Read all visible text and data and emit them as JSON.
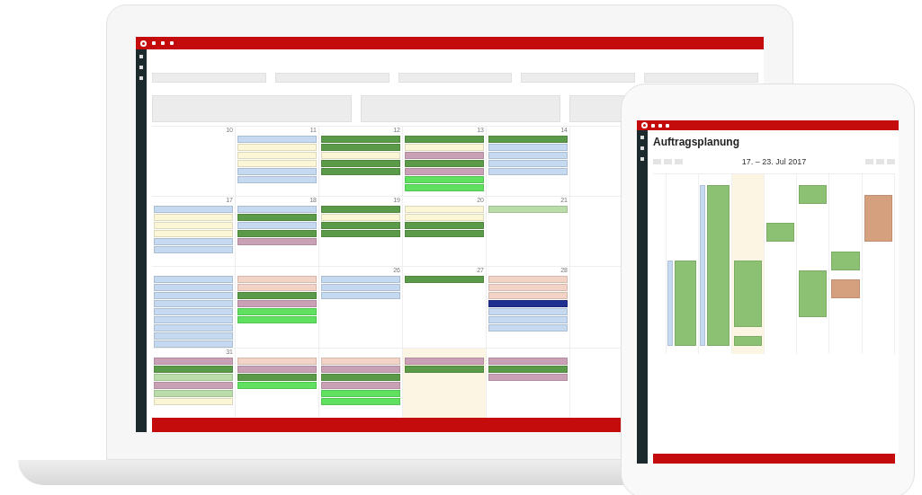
{
  "laptop": {
    "form": [
      {
        "kind": "input"
      },
      {
        "kind": "input"
      },
      {
        "kind": "input"
      },
      {
        "kind": "input"
      },
      {
        "kind": "input"
      },
      {
        "kind": "textarea"
      },
      {
        "kind": "textarea"
      },
      {
        "kind": "textarea"
      }
    ],
    "calendar": {
      "weeks": [
        {
          "days": [
            {
              "number": "10",
              "highlighted": false
            },
            {
              "number": "11",
              "highlighted": false,
              "events": [
                {
                  "color": "#c5d9f1"
                },
                {
                  "color": "#fbf6d5"
                },
                {
                  "color": "#fbf6d5"
                },
                {
                  "color": "#fbf6d5"
                },
                {
                  "color": "#c5d9f1"
                },
                {
                  "color": "#c5d9f1"
                }
              ]
            },
            {
              "number": "12",
              "highlighted": false,
              "events": [
                {
                  "color": "#5a9a48"
                },
                {
                  "color": "#5a9a48"
                },
                {
                  "color": "#fbf6d5"
                },
                {
                  "color": "#5a9a48"
                },
                {
                  "color": "#5a9a48"
                }
              ]
            },
            {
              "number": "13",
              "highlighted": false,
              "events": [
                {
                  "color": "#5a9a48"
                },
                {
                  "color": "#fbf6d5"
                },
                {
                  "color": "#c9a0b5"
                },
                {
                  "color": "#5a9a48"
                },
                {
                  "color": "#c9a0b5"
                },
                {
                  "color": "#5fe05f"
                },
                {
                  "color": "#5fe05f"
                }
              ]
            },
            {
              "number": "14",
              "highlighted": false,
              "events": [
                {
                  "color": "#5a9a48"
                },
                {
                  "color": "#c5d9f1"
                },
                {
                  "color": "#c5d9f1"
                },
                {
                  "color": "#c5d9f1"
                },
                {
                  "color": "#c5d9f1"
                }
              ]
            }
          ]
        },
        {
          "days": [
            {
              "number": "17",
              "highlighted": false,
              "events": [
                {
                  "color": "#c5d9f1"
                },
                {
                  "color": "#fbf6d5"
                },
                {
                  "color": "#fbf6d5"
                },
                {
                  "color": "#fbf6d5"
                },
                {
                  "color": "#c5d9f1"
                },
                {
                  "color": "#c5d9f1"
                }
              ]
            },
            {
              "number": "18",
              "highlighted": false,
              "events": [
                {
                  "color": "#c5d9f1"
                },
                {
                  "color": "#5a9a48"
                },
                {
                  "color": "#c5d9f1"
                },
                {
                  "color": "#5a9a48"
                },
                {
                  "color": "#c9a0b5"
                }
              ]
            },
            {
              "number": "19",
              "highlighted": false,
              "events": [
                {
                  "color": "#5a9a48"
                },
                {
                  "color": "#fbf6d5"
                },
                {
                  "color": "#5a9a48"
                },
                {
                  "color": "#5a9a48"
                }
              ]
            },
            {
              "number": "20",
              "highlighted": false,
              "events": [
                {
                  "color": "#fbf6d5"
                },
                {
                  "color": "#fbf6d5"
                },
                {
                  "color": "#5a9a48"
                },
                {
                  "color": "#5a9a48"
                }
              ]
            },
            {
              "number": "21",
              "highlighted": false,
              "events": [
                {
                  "color": "#b9dca8"
                }
              ]
            }
          ]
        },
        {
          "days": [
            {
              "highlighted": false,
              "events": [
                {
                  "color": "#c5d9f1"
                },
                {
                  "color": "#c5d9f1"
                },
                {
                  "color": "#c5d9f1"
                },
                {
                  "color": "#c5d9f1"
                },
                {
                  "color": "#c5d9f1"
                },
                {
                  "color": "#c5d9f1"
                },
                {
                  "color": "#c5d9f1"
                },
                {
                  "color": "#c5d9f1"
                },
                {
                  "color": "#c5d9f1"
                }
              ]
            },
            {
              "highlighted": false,
              "events": [
                {
                  "color": "#f2d3c6"
                },
                {
                  "color": "#f2d3c6"
                },
                {
                  "color": "#5a9a48"
                },
                {
                  "color": "#c9a0b5"
                },
                {
                  "color": "#5fe05f"
                },
                {
                  "color": "#5fe05f"
                }
              ]
            },
            {
              "number": "26",
              "highlighted": false,
              "events": [
                {
                  "color": "#c5d9f1"
                },
                {
                  "color": "#c5d9f1"
                },
                {
                  "color": "#c5d9f1"
                }
              ]
            },
            {
              "number": "27",
              "highlighted": false,
              "events": [
                {
                  "color": "#5a9a48"
                }
              ]
            },
            {
              "number": "28",
              "highlighted": false,
              "events": [
                {
                  "color": "#f2d3c6"
                },
                {
                  "color": "#f2d3c6"
                },
                {
                  "color": "#f2d3c6"
                },
                {
                  "color": "#1f2f8f"
                },
                {
                  "color": "#c5d9f1"
                },
                {
                  "color": "#c5d9f1"
                },
                {
                  "color": "#c5d9f1"
                }
              ]
            }
          ]
        },
        {
          "days": [
            {
              "number": "31",
              "highlighted": false,
              "events": [
                {
                  "color": "#c9a0b5"
                },
                {
                  "color": "#5a9a48"
                },
                {
                  "color": "#b9dca8"
                },
                {
                  "color": "#c9a0b5"
                },
                {
                  "color": "#b9dca8"
                },
                {
                  "color": "#fbf6d5"
                }
              ]
            },
            {
              "highlighted": false,
              "events": [
                {
                  "color": "#f2d3c6"
                },
                {
                  "color": "#c9a0b5"
                },
                {
                  "color": "#5a9a48"
                },
                {
                  "color": "#5fe05f"
                }
              ]
            },
            {
              "highlighted": false,
              "events": [
                {
                  "color": "#f2d3c6"
                },
                {
                  "color": "#c9a0b5"
                },
                {
                  "color": "#5a9a48"
                },
                {
                  "color": "#c9a0b5"
                },
                {
                  "color": "#5fe05f"
                },
                {
                  "color": "#5fe05f"
                }
              ]
            },
            {
              "highlighted": true,
              "events": [
                {
                  "color": "#c9a0b5"
                },
                {
                  "color": "#5a9a48"
                }
              ]
            },
            {
              "highlighted": false,
              "events": [
                {
                  "color": "#c9a0b5"
                },
                {
                  "color": "#5a9a48"
                },
                {
                  "color": "#c9a0b5"
                }
              ]
            }
          ]
        }
      ]
    }
  },
  "tablet": {
    "title": "Auftragsplanung",
    "range": "17. – 23. Jul 2017",
    "days": [
      {
        "highlighted": false,
        "slots": [
          {
            "kind": "free"
          },
          {
            "kind": "free"
          },
          {
            "kind": "free"
          },
          {
            "kind": "free"
          },
          {
            "kind": "free"
          },
          {
            "kind": "free"
          },
          {
            "kind": "free"
          },
          {
            "kind": "free"
          },
          {
            "kind": "paired"
          },
          {
            "kind": "paired"
          },
          {
            "kind": "paired"
          },
          {
            "kind": "paired"
          },
          {
            "kind": "paired"
          },
          {
            "kind": "paired"
          },
          {
            "kind": "paired"
          },
          {
            "kind": "paired"
          },
          {
            "kind": "paired"
          }
        ]
      },
      {
        "highlighted": false,
        "slots": [
          {
            "kind": "paired"
          },
          {
            "kind": "paired"
          },
          {
            "kind": "paired"
          },
          {
            "kind": "paired"
          },
          {
            "kind": "paired"
          },
          {
            "kind": "paired"
          },
          {
            "kind": "paired"
          },
          {
            "kind": "paired"
          },
          {
            "kind": "paired"
          },
          {
            "kind": "paired"
          },
          {
            "kind": "paired"
          },
          {
            "kind": "paired"
          },
          {
            "kind": "paired"
          },
          {
            "kind": "paired"
          },
          {
            "kind": "paired"
          },
          {
            "kind": "paired"
          },
          {
            "kind": "paired"
          }
        ]
      },
      {
        "highlighted": true,
        "slots": [
          {
            "kind": "free"
          },
          {
            "kind": "free"
          },
          {
            "kind": "free"
          },
          {
            "kind": "free"
          },
          {
            "kind": "free"
          },
          {
            "kind": "free"
          },
          {
            "kind": "free"
          },
          {
            "kind": "free"
          },
          {
            "kind": "busy"
          },
          {
            "kind": "busy"
          },
          {
            "kind": "busy"
          },
          {
            "kind": "busy"
          },
          {
            "kind": "busy"
          },
          {
            "kind": "busy"
          },
          {
            "kind": "busy"
          },
          {
            "kind": "free"
          },
          {
            "kind": "busy"
          }
        ]
      },
      {
        "highlighted": false,
        "slots": [
          {
            "kind": "free"
          },
          {
            "kind": "free"
          },
          {
            "kind": "free"
          },
          {
            "kind": "free"
          },
          {
            "kind": "busy"
          },
          {
            "kind": "busy"
          },
          {
            "kind": "free"
          },
          {
            "kind": "free"
          },
          {
            "kind": "free"
          },
          {
            "kind": "free"
          },
          {
            "kind": "free"
          },
          {
            "kind": "free"
          },
          {
            "kind": "free"
          },
          {
            "kind": "free"
          },
          {
            "kind": "free"
          },
          {
            "kind": "free"
          },
          {
            "kind": "free"
          }
        ]
      },
      {
        "highlighted": false,
        "slots": [
          {
            "kind": "busy"
          },
          {
            "kind": "busy"
          },
          {
            "kind": "free"
          },
          {
            "kind": "free"
          },
          {
            "kind": "free"
          },
          {
            "kind": "free"
          },
          {
            "kind": "free"
          },
          {
            "kind": "free"
          },
          {
            "kind": "free"
          },
          {
            "kind": "busy"
          },
          {
            "kind": "busy"
          },
          {
            "kind": "busy"
          },
          {
            "kind": "busy"
          },
          {
            "kind": "busy"
          },
          {
            "kind": "free"
          },
          {
            "kind": "free"
          },
          {
            "kind": "free"
          }
        ]
      },
      {
        "highlighted": false,
        "slots": [
          {
            "kind": "free"
          },
          {
            "kind": "free"
          },
          {
            "kind": "free"
          },
          {
            "kind": "free"
          },
          {
            "kind": "free"
          },
          {
            "kind": "free"
          },
          {
            "kind": "free"
          },
          {
            "kind": "busy"
          },
          {
            "kind": "busy"
          },
          {
            "kind": "free"
          },
          {
            "kind": "alt"
          },
          {
            "kind": "alt"
          },
          {
            "kind": "free"
          },
          {
            "kind": "free"
          },
          {
            "kind": "free"
          },
          {
            "kind": "free"
          },
          {
            "kind": "free"
          }
        ]
      },
      {
        "highlighted": false,
        "slots": [
          {
            "kind": "free"
          },
          {
            "kind": "alt"
          },
          {
            "kind": "alt"
          },
          {
            "kind": "alt"
          },
          {
            "kind": "alt"
          },
          {
            "kind": "alt"
          },
          {
            "kind": "free"
          },
          {
            "kind": "free"
          },
          {
            "kind": "free"
          },
          {
            "kind": "free"
          },
          {
            "kind": "free"
          },
          {
            "kind": "free"
          },
          {
            "kind": "free"
          },
          {
            "kind": "free"
          },
          {
            "kind": "free"
          },
          {
            "kind": "free"
          },
          {
            "kind": "free"
          }
        ]
      }
    ]
  }
}
